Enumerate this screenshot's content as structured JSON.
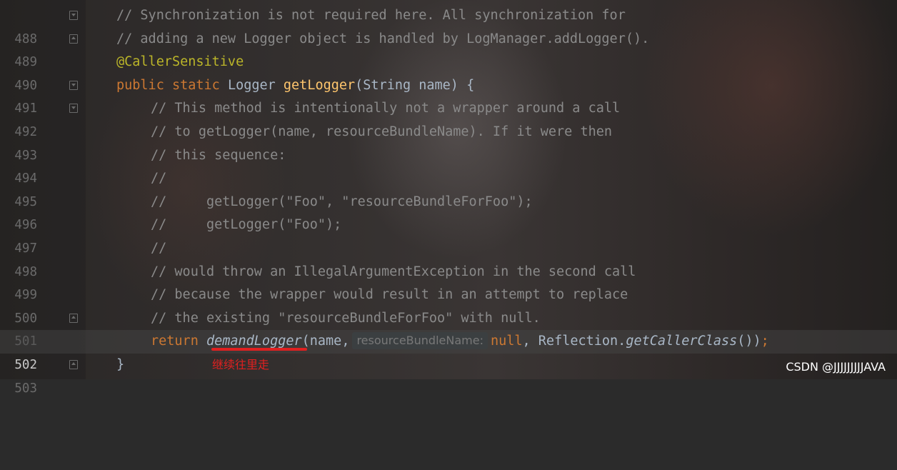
{
  "lines": [
    {
      "num": "488",
      "text": "// Synchronization is not required here. All synchronization for"
    },
    {
      "num": "489",
      "text": "// adding a new Logger object is handled by LogManager.addLogger()."
    },
    {
      "num": "490",
      "text": "@CallerSensitive"
    },
    {
      "num": "491",
      "kw": "public static ",
      "type": "Logger ",
      "fn": "getLogger",
      "rest": "(String name) {"
    },
    {
      "num": "492",
      "text": "// This method is intentionally not a wrapper around a call"
    },
    {
      "num": "493",
      "text": "// to getLogger(name, resourceBundleName). If it were then"
    },
    {
      "num": "494",
      "text": "// this sequence:"
    },
    {
      "num": "495",
      "text": "//"
    },
    {
      "num": "496",
      "text": "//     getLogger(\"Foo\", \"resourceBundleForFoo\");"
    },
    {
      "num": "497",
      "text": "//     getLogger(\"Foo\");"
    },
    {
      "num": "498",
      "text": "//"
    },
    {
      "num": "499",
      "text": "// would throw an IllegalArgumentException in the second call"
    },
    {
      "num": "500",
      "text": "// because the wrapper would result in an attempt to replace"
    },
    {
      "num": "501",
      "text": "// the existing \"resourceBundleForFoo\" with null."
    },
    {
      "num": "502",
      "kw": "return ",
      "call": "demandLogger",
      "args_start": "(name,",
      "hint": "resourceBundleName:",
      "null_kw": "null",
      "args_mid": ", Reflection.",
      "call2": "getCallerClass",
      "args_end": "())",
      "semi": ";"
    },
    {
      "num": "503",
      "text": "}"
    }
  ],
  "annotation_note": "继续往里走",
  "watermark": "CSDN @JJJJJJJJJAVA"
}
